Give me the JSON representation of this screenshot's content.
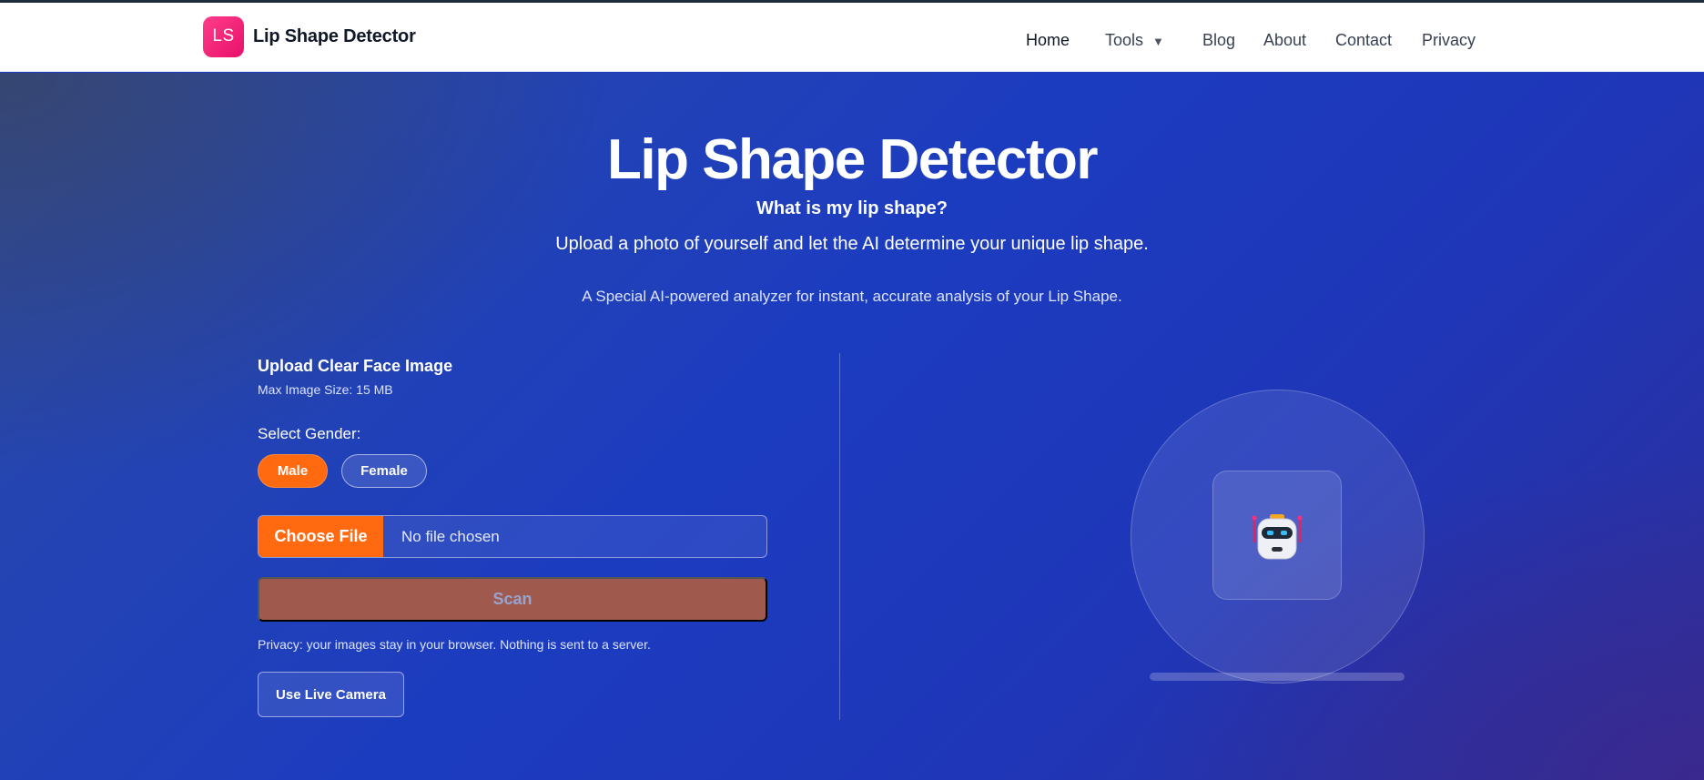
{
  "navbar": {
    "logo_initials": "LS",
    "brand_name": "Lip Shape Detector",
    "links": [
      {
        "label": "Home",
        "active": true
      },
      {
        "label": "Tools",
        "has_dropdown": true,
        "caret": "▼"
      },
      {
        "label": "Blog"
      },
      {
        "label": "About"
      },
      {
        "label": "Contact"
      },
      {
        "label": "Privacy"
      }
    ]
  },
  "hero": {
    "title": "Lip Shape Detector",
    "subtitle": "What is my lip shape?",
    "lead": "Upload a photo of yourself and let the AI determine your unique lip shape.",
    "description": "A Special AI-powered analyzer for instant, accurate analysis of your Lip Shape."
  },
  "upload": {
    "label": "Upload Clear Face Image",
    "max_size": "Max Image Size: 15 MB",
    "gender_label": "Select Gender:",
    "gender_options": [
      {
        "label": "Male",
        "selected": true
      },
      {
        "label": "Female",
        "selected": false
      }
    ],
    "choose_file_label": "Choose File",
    "file_status": "No file chosen",
    "scan_label": "Scan",
    "scan_enabled": false,
    "privacy_note": "Privacy: your images stay in your browser. Nothing is sent to a server.",
    "camera_label": "Use Live Camera"
  },
  "illustration": {
    "icon": "robot-icon"
  },
  "colors": {
    "accent": "#ff6a10",
    "logo": "#ff2d7a",
    "hero_bg": "#1c3cc0",
    "scan_disabled": "#a05a4d"
  }
}
